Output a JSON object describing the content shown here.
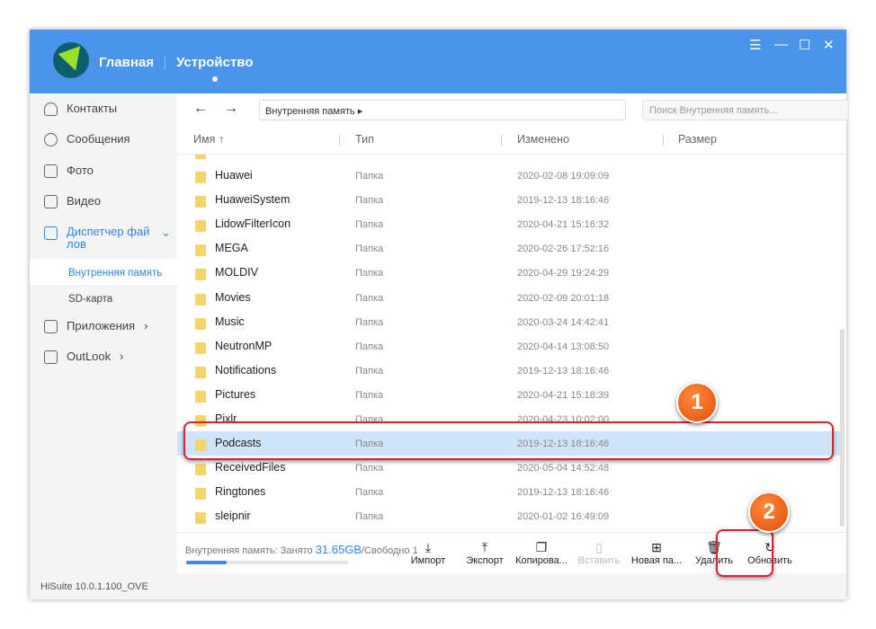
{
  "header": {
    "nav": [
      "Главная",
      "Устройство"
    ],
    "window_controls": [
      "menu-icon",
      "minimize-icon",
      "maximize-icon",
      "close-icon"
    ]
  },
  "sidebar": {
    "items": [
      {
        "label": "Контакты",
        "icon": "contacts-icon"
      },
      {
        "label": "Сообщения",
        "icon": "messages-icon"
      },
      {
        "label": "Фото",
        "icon": "photo-icon"
      },
      {
        "label": "Видео",
        "icon": "video-icon"
      },
      {
        "label": "Диспетчер фай\nлов",
        "icon": "folder-icon",
        "active": true
      },
      {
        "label": "Приложения",
        "icon": "apps-icon"
      },
      {
        "label": "OutLook",
        "icon": "mail-icon"
      }
    ],
    "subitems": [
      "Внутренняя память",
      "SD-карта"
    ]
  },
  "toolbar": {
    "path": "Внутренняя память  ▸",
    "search_placeholder": "Поиск Внутренняя память..."
  },
  "columns": [
    "Имя ↑",
    "Тип",
    "Изменено",
    "Размер"
  ],
  "files": [
    {
      "name": "Huawei",
      "type": "Папка",
      "date": "2020-02-08 19:09:09"
    },
    {
      "name": "HuaweiSystem",
      "type": "Папка",
      "date": "2019-12-13 18:16:46"
    },
    {
      "name": "LidowFilterIcon",
      "type": "Папка",
      "date": "2020-04-21 15:16:32"
    },
    {
      "name": "MEGA",
      "type": "Папка",
      "date": "2020-02-26 17:52:16"
    },
    {
      "name": "MOLDIV",
      "type": "Папка",
      "date": "2020-04-29 19:24:29"
    },
    {
      "name": "Movies",
      "type": "Папка",
      "date": "2020-02-09 20:01:18"
    },
    {
      "name": "Music",
      "type": "Папка",
      "date": "2020-03-24 14:42:41"
    },
    {
      "name": "NeutronMP",
      "type": "Папка",
      "date": "2020-04-14 13:08:50"
    },
    {
      "name": "Notifications",
      "type": "Папка",
      "date": "2019-12-13 18:16:46"
    },
    {
      "name": "Pictures",
      "type": "Папка",
      "date": "2020-04-21 15:18:39"
    },
    {
      "name": "Pixlr",
      "type": "Папка",
      "date": "2020-04-23 10:02:00"
    },
    {
      "name": "Podcasts",
      "type": "Папка",
      "date": "2019-12-13 18:16:46",
      "selected": true
    },
    {
      "name": "ReceivedFiles",
      "type": "Папка",
      "date": "2020-05-04 14:52:48"
    },
    {
      "name": "Ringtones",
      "type": "Папка",
      "date": "2019-12-13 18:16:46"
    },
    {
      "name": "sleipnir",
      "type": "Папка",
      "date": "2020-01-02 16:49:09"
    }
  ],
  "storage": {
    "prefix": "Внутренняя память: Занято ",
    "used": "31.65GB",
    "suffix": "/Свободно 1",
    "used_fraction": 0.25
  },
  "actions": [
    {
      "label": "Импорт",
      "icon": "import-icon"
    },
    {
      "label": "Экспорт",
      "icon": "export-icon"
    },
    {
      "label": "Копирова...",
      "icon": "copy-icon"
    },
    {
      "label": "Вставить",
      "icon": "paste-icon",
      "disabled": true
    },
    {
      "label": "Новая па...",
      "icon": "new-folder-icon"
    },
    {
      "label": "Удалить",
      "icon": "trash-icon"
    },
    {
      "label": "Обновить",
      "icon": "refresh-icon"
    }
  ],
  "footer": "HiSuite 10.0.1.100_OVE",
  "annotations": [
    "1",
    "2"
  ],
  "colors": {
    "header": "#4a94ec",
    "selected": "#cfe3f9",
    "annotation": "#e0202a"
  }
}
